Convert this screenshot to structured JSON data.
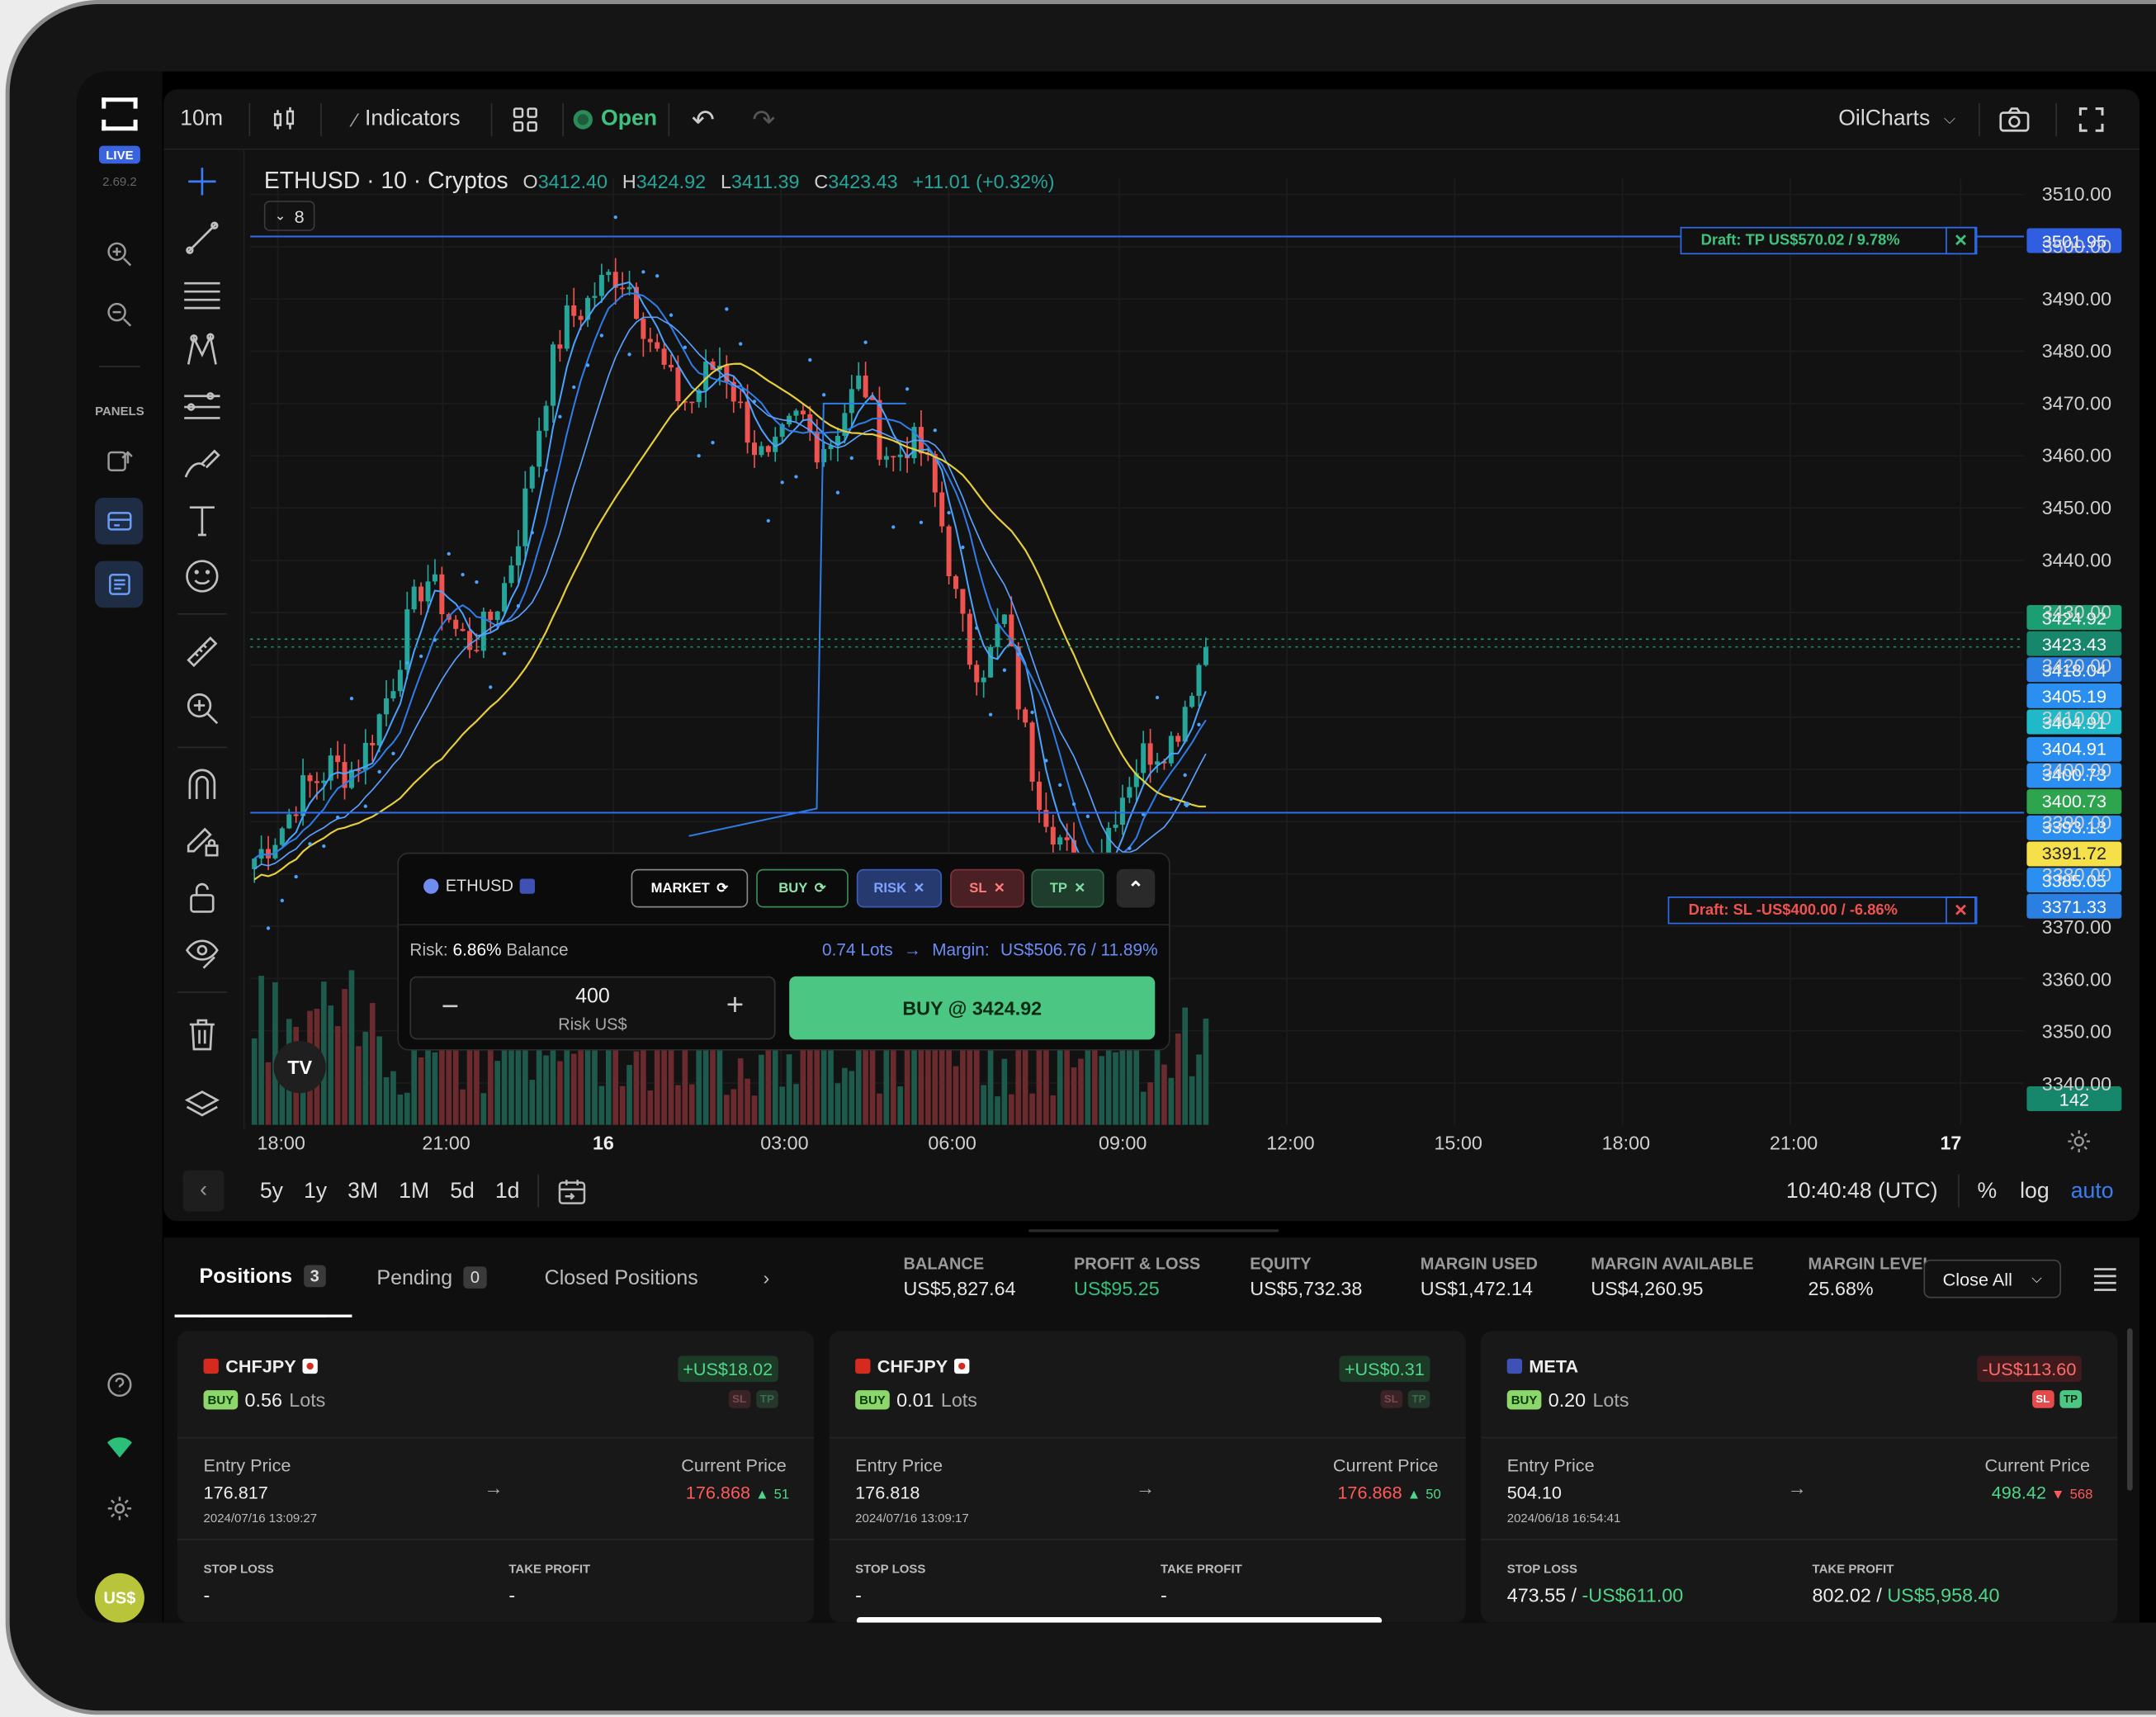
{
  "app": {
    "version": "2.69.2",
    "live_badge": "LIVE",
    "panels_label": "PANELS",
    "currency_avatar": "US$"
  },
  "topbar": {
    "interval": "10m",
    "indicators": "Indicators",
    "market_status": "Open",
    "layout_name": "OilCharts"
  },
  "legend": {
    "symbol": "ETHUSD · 10 · Cryptos",
    "o_label": "O",
    "o": "3412.40",
    "h_label": "H",
    "h": "3424.92",
    "l_label": "L",
    "l": "3411.39",
    "c_label": "C",
    "c": "3423.43",
    "change": "+11.01 (+0.32%)",
    "collapse_count": "8"
  },
  "drafts": {
    "tp": "Draft: TP US$570.02 / 9.78%",
    "tp_price": "3501.95",
    "sl": "Draft: SL -US$400.00 / -6.86%"
  },
  "chart_data": {
    "type": "candlestick",
    "symbol": "ETHUSD",
    "interval": "10",
    "ylim": [
      3332,
      3513
    ],
    "y_ticks": [
      "3510.00",
      "3500.00",
      "3490.00",
      "3480.00",
      "3470.00",
      "3460.00",
      "3450.00",
      "3440.00",
      "3430.00",
      "3420.00",
      "3410.00",
      "3400.00",
      "3390.00",
      "3380.00",
      "3370.00",
      "3360.00",
      "3350.00",
      "3340.00"
    ],
    "x_ticks": [
      "18:00",
      "21:00",
      "16",
      "03:00",
      "06:00",
      "09:00",
      "12:00",
      "15:00",
      "18:00",
      "21:00",
      "17"
    ],
    "close_path": [
      3383,
      3386,
      3390,
      3396,
      3398,
      3401,
      3399,
      3403,
      3410,
      3418,
      3430,
      3437,
      3432,
      3426,
      3424,
      3428,
      3435,
      3446,
      3462,
      3477,
      3486,
      3488,
      3492,
      3495,
      3493,
      3485,
      3478,
      3472,
      3470,
      3476,
      3478,
      3470,
      3462,
      3458,
      3464,
      3468,
      3462,
      3463,
      3470,
      3475,
      3463,
      3459,
      3463,
      3460,
      3448,
      3432,
      3420,
      3420,
      3430,
      3413,
      3398,
      3390,
      3385,
      3376,
      3382,
      3391,
      3398,
      3403,
      3404,
      3406,
      3416,
      3423.43
    ],
    "price_tags": [
      {
        "value": "3424.92",
        "color": "#1b9e72"
      },
      {
        "value": "3423.43",
        "color": "#16876a"
      },
      {
        "value": "3418.04",
        "color": "#2a7fe0"
      },
      {
        "value": "3405.19",
        "color": "#2a8ff0"
      },
      {
        "value": "3404.91",
        "color": "#1fb9c9"
      },
      {
        "value": "3404.91",
        "color": "#2a8ff0"
      },
      {
        "value": "3400.73",
        "color": "#2a8ff0"
      },
      {
        "value": "3400.73",
        "color": "#2ea44f"
      },
      {
        "value": "3393.13",
        "color": "#2a8ff0"
      },
      {
        "value": "3391.72",
        "color": "#f5e04a"
      },
      {
        "value": "3385.05",
        "color": "#2a8ff0"
      },
      {
        "value": "3371.33",
        "color": "#2a7fe0"
      }
    ],
    "volume_tag": "142"
  },
  "bottombar": {
    "ranges": [
      "5y",
      "1y",
      "3M",
      "1M",
      "5d",
      "1d"
    ],
    "time": "10:40:48 (UTC)",
    "percent": "%",
    "log": "log",
    "auto": "auto"
  },
  "trade_panel": {
    "symbol": "ETHUSD",
    "market": "MARKET",
    "buy": "BUY",
    "risk": "RISK",
    "sl": "SL",
    "tp": "TP",
    "risk_label": "Risk:",
    "risk_pct": "6.86%",
    "balance_word": "Balance",
    "lots": "0.74 Lots",
    "margin_label": "Margin:",
    "margin_value": "US$506.76 / 11.89%",
    "amount": "400",
    "amount_label": "Risk US$",
    "buy_button": "BUY @ 3424.92"
  },
  "tabs": [
    {
      "label": "Positions",
      "count": "3"
    },
    {
      "label": "Pending",
      "count": "0"
    },
    {
      "label": "Closed Positions"
    }
  ],
  "stats": [
    {
      "k": "BALANCE",
      "v": "US$5,827.64",
      "color": "#e6e6e6"
    },
    {
      "k": "PROFIT & LOSS",
      "v": "US$95.25",
      "color": "#33c07a"
    },
    {
      "k": "EQUITY",
      "v": "US$5,732.38",
      "color": "#e6e6e6"
    },
    {
      "k": "MARGIN USED",
      "v": "US$1,472.14",
      "color": "#e6e6e6"
    },
    {
      "k": "MARGIN AVAILABLE",
      "v": "US$4,260.95",
      "color": "#e6e6e6"
    },
    {
      "k": "MARGIN LEVEL",
      "v": "25.68%",
      "color": "#e6e6e6"
    }
  ],
  "close_all": "Close All",
  "positions": [
    {
      "symbol": "CHFJPY",
      "side": "BUY",
      "lots": "0.56",
      "lots_word": "Lots",
      "pnl": "+US$18.02",
      "pnl_positive": true,
      "sl": "SL",
      "tp": "TP",
      "entry_label": "Entry Price",
      "entry": "176.817",
      "date": "2024/07/16 13:09:27",
      "current_label": "Current Price",
      "current": "176.868",
      "delta": "51",
      "delta_up": true,
      "stop_label": "STOP LOSS",
      "stop": "-",
      "take_label": "TAKE PROFIT",
      "take": "-"
    },
    {
      "symbol": "CHFJPY",
      "side": "BUY",
      "lots": "0.01",
      "lots_word": "Lots",
      "pnl": "+US$0.31",
      "pnl_positive": true,
      "sl": "SL",
      "tp": "TP",
      "entry_label": "Entry Price",
      "entry": "176.818",
      "date": "2024/07/16 13:09:17",
      "current_label": "Current Price",
      "current": "176.868",
      "delta": "50",
      "delta_up": true,
      "stop_label": "STOP LOSS",
      "stop": "-",
      "take_label": "TAKE PROFIT",
      "take": "-"
    },
    {
      "symbol": "META",
      "side": "BUY",
      "lots": "0.20",
      "lots_word": "Lots",
      "pnl": "-US$113.60",
      "pnl_positive": false,
      "sl": "SL",
      "tp": "TP",
      "entry_label": "Entry Price",
      "entry": "504.10",
      "date": "2024/06/18 16:54:41",
      "current_label": "Current Price",
      "current": "498.42",
      "delta": "568",
      "delta_up": false,
      "stop_label": "STOP LOSS",
      "stop": "473.55 /",
      "stop_extra": "-US$611.00",
      "take_label": "TAKE PROFIT",
      "take": "802.02 /",
      "take_extra": "US$5,958.40"
    }
  ]
}
